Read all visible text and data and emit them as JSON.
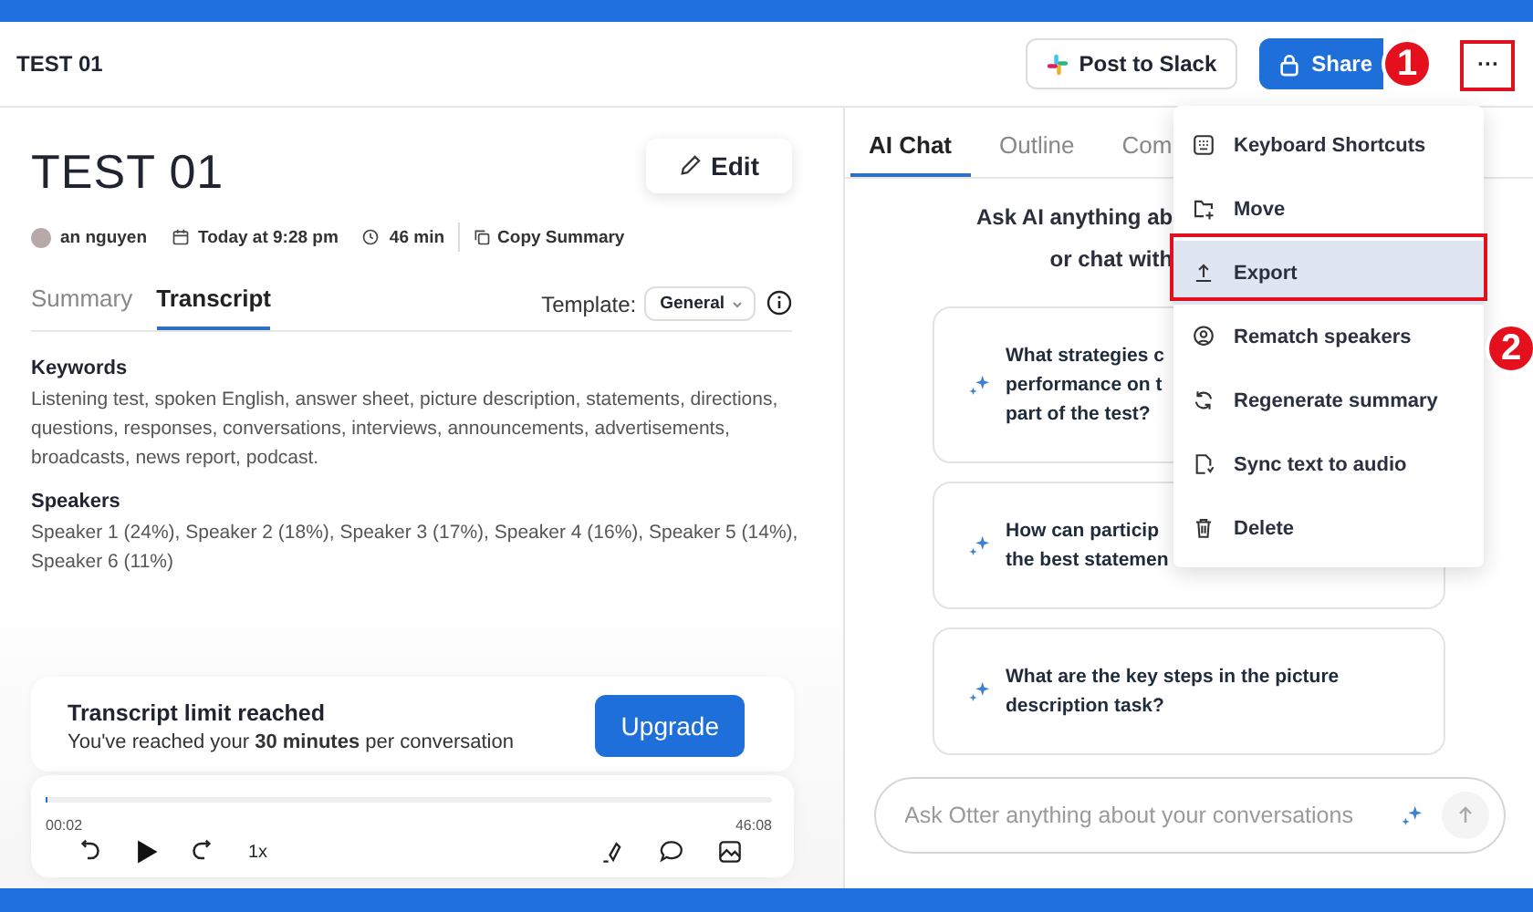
{
  "header": {
    "title": "TEST 01",
    "slack_button": "Post to Slack",
    "share_button": "Share",
    "more_button": "···"
  },
  "note": {
    "title": "TEST 01",
    "edit_button": "Edit",
    "owner": "an nguyen",
    "date": "Today at 9:28 pm",
    "duration": "46 min",
    "copy_button": "Copy Summary"
  },
  "tabs": [
    {
      "label": "Summary",
      "selected": false
    },
    {
      "label": "Transcript",
      "selected": true
    }
  ],
  "template": {
    "label": "Template:",
    "value": "General"
  },
  "sections": [
    {
      "heading": "Keywords",
      "text": "Listening test, spoken English, answer sheet, picture description, statements, directions, questions, responses, conversations, interviews, announcements, advertisements, broadcasts, news report, podcast."
    },
    {
      "heading": "Speakers",
      "text": "Speaker 1 (24%), Speaker 2 (18%), Speaker 3 (17%), Speaker 4 (16%), Speaker 5 (14%), Speaker 6 (11%)"
    }
  ],
  "limit_card": {
    "title": "Transcript limit reached",
    "message": "You've reached your **30 minutes** per conversation",
    "button": "Upgrade"
  },
  "player": {
    "elapsed": "00:02",
    "total": "46:08",
    "speed": "1x",
    "level": 0.001
  },
  "chat_tabs": [
    {
      "label": "AI Chat",
      "selected": true
    },
    {
      "label": "Outline",
      "selected": false
    },
    {
      "label": "Com",
      "selected": false
    }
  ],
  "chat_prompt": [
    "Ask AI anything ab",
    "or chat with"
  ],
  "suggestions": [
    [
      "What strategies c",
      "performance on t",
      "part of the test?"
    ],
    [
      "How can particip",
      "the best statemen"
    ],
    [
      "What are the key steps in the picture",
      "description task?"
    ]
  ],
  "chat_input": {
    "placeholder": "Ask Otter anything about your conversations"
  },
  "menu": [
    {
      "label": "Keyboard Shortcuts",
      "selected": false
    },
    {
      "label": "Move",
      "selected": false
    },
    {
      "label": "Export",
      "selected": true
    },
    {
      "label": "Rematch speakers",
      "selected": false
    },
    {
      "label": "Regenerate summary",
      "selected": false
    },
    {
      "label": "Sync text to audio",
      "selected": false
    },
    {
      "label": "Delete",
      "selected": false
    }
  ],
  "callouts": [
    "1",
    "2"
  ]
}
